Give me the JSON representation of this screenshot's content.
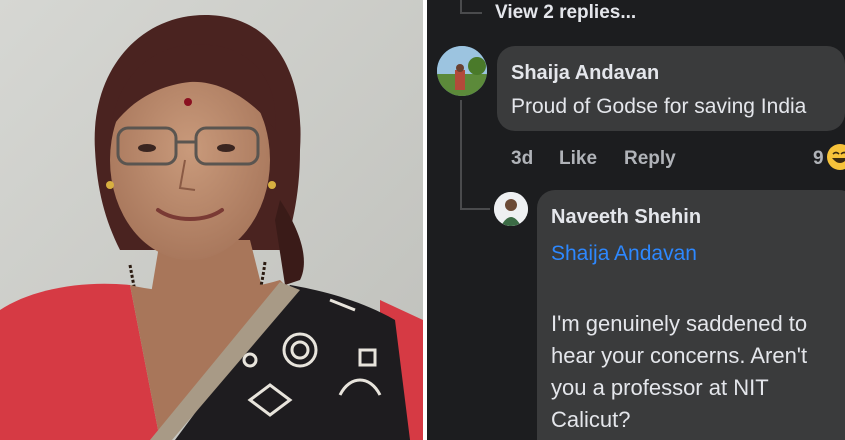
{
  "comments": [
    {
      "author": "Shaija Andavan",
      "text": "Proud of Godse for saving India",
      "time": "3d",
      "like_label": "Like",
      "reply_label": "Reply",
      "reaction_count": "9",
      "reaction_icon": "laughing-emoji-icon"
    },
    {
      "author": "Naveeth Shehin",
      "mention": "Shaija Andavan",
      "body_lines": [
        "I'm genuinely saddened to",
        "hear your concerns. Aren't",
        "you a professor at NIT",
        "Calicut?"
      ]
    }
  ],
  "thread": {
    "view_replies": "View 2 replies..."
  },
  "colors": {
    "background": "#1c1d1f",
    "bubble": "#3a3b3c",
    "mention": "#2d88ff",
    "meta": "#b0b3b8",
    "saree_red": "#d63a44"
  }
}
